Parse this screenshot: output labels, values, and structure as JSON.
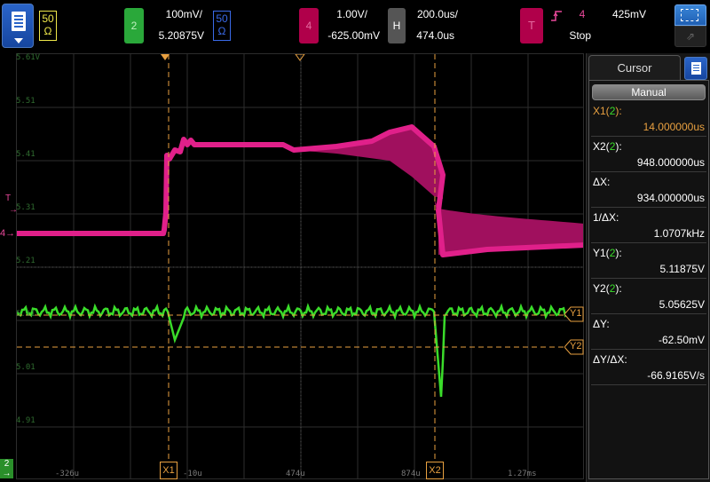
{
  "menu": {
    "icon": "menu-icon"
  },
  "channels": {
    "ch1": {
      "impedance_top": "50",
      "impedance_bottom": "Ω",
      "color": "#f0e84a"
    },
    "ch2": {
      "number": "2",
      "volts_div": "100mV/",
      "offset": "5.20875V",
      "color": "#2aa83a"
    },
    "ch3": {
      "impedance_top": "50",
      "impedance_bottom": "Ω",
      "color": "#3a6ae8"
    },
    "ch4": {
      "number": "4",
      "volts_div": "1.00V/",
      "offset": "-625.00mV",
      "color": "#e8489a"
    }
  },
  "horizontal": {
    "label": "H",
    "time_div": "200.0us/",
    "position": "474.0us"
  },
  "trigger": {
    "label": "T",
    "source": "4",
    "level": "425mV",
    "status": "Stop",
    "color": "#e8489a"
  },
  "scale_labels": [
    "5.61V",
    "5.51",
    "5.41",
    "5.31",
    "5.21",
    "5.11",
    "5.01",
    "4.91"
  ],
  "time_labels": [
    "-326u",
    "-10u",
    "474u",
    "874u",
    "1.27ms"
  ],
  "cursor_markers": {
    "x1": "X1",
    "x2": "X2",
    "y1": "Y1",
    "y2": "Y2"
  },
  "ground_marker": {
    "ch": "2",
    "arrow": "→"
  },
  "trigger_marker": "T",
  "ch4_marker": "4",
  "side_panel": {
    "title": "Cursor",
    "mode": "Manual",
    "x1_label": "X1(2):",
    "x1_value": "14.000000us",
    "x2_label": "X2(2):",
    "x2_value": "948.000000us",
    "dx_label": "ΔX:",
    "dx_value": "934.000000us",
    "inv_dx_label": "1/ΔX:",
    "inv_dx_value": "1.0707kHz",
    "y1_label": "Y1(2):",
    "y1_value": "5.11875V",
    "y2_label": "Y2(2):",
    "y2_value": "5.05625V",
    "dy_label": "ΔY:",
    "dy_value": "-62.50mV",
    "dydx_label": "ΔY/ΔX:",
    "dydx_value": "-66.9165V/s"
  },
  "colors": {
    "cursor": "#e8a040",
    "ch2_trace": "#3adc2a",
    "ch4_trace": "#e0208a",
    "ch4_band": "#a0105e",
    "grid": "#3a3a3a"
  }
}
